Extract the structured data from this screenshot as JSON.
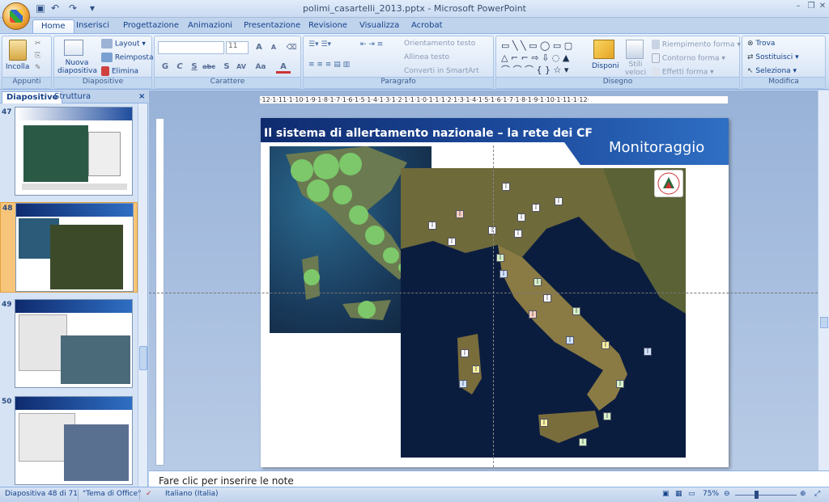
{
  "window": {
    "title": "polimi_casartelli_2013.pptx - Microsoft PowerPoint",
    "controls": {
      "minimize": "–",
      "maximize": "❐",
      "close": "✕"
    }
  },
  "qat": {
    "save_icon": "save-icon",
    "undo_icon": "undo-icon",
    "redo_icon": "redo-icon",
    "customize": "▾"
  },
  "tabs": [
    {
      "label": "Home",
      "active": true
    },
    {
      "label": "Inserisci"
    },
    {
      "label": "Progettazione"
    },
    {
      "label": "Animazioni"
    },
    {
      "label": "Presentazione"
    },
    {
      "label": "Revisione"
    },
    {
      "label": "Visualizza"
    },
    {
      "label": "Acrobat"
    }
  ],
  "ribbon": {
    "appunti": {
      "label": "Appunti",
      "incolla": "Incolla"
    },
    "diapositive": {
      "label": "Diapositive",
      "nuova": "Nuova diapositiva",
      "layout": "Layout",
      "reimposta": "Reimposta",
      "elimina": "Elimina"
    },
    "carattere": {
      "label": "Carattere",
      "font_size": "11",
      "grow": "A",
      "shrink": "A",
      "bold": "G",
      "italic": "C",
      "underline": "S",
      "strike": "abc",
      "shadow": "S",
      "spacing": "AV",
      "case": "Aa",
      "color": "A"
    },
    "paragrafo": {
      "label": "Paragrafo",
      "orientamento": "Orientamento testo",
      "allinea": "Allinea testo",
      "smartart": "Converti in SmartArt"
    },
    "disegno": {
      "label": "Disegno",
      "disponi": "Disponi",
      "stili": "Stili veloci",
      "riempimento": "Riempimento forma",
      "contorno": "Contorno forma",
      "effetti": "Effetti forma"
    },
    "modifica": {
      "label": "Modifica",
      "trova": "Trova",
      "sostituisci": "Sostituisci",
      "seleziona": "Seleziona"
    }
  },
  "pane": {
    "tabs": [
      "Diapositive",
      "Struttura"
    ],
    "close": "×",
    "thumbs": [
      {
        "num": "47"
      },
      {
        "num": "48",
        "selected": true
      },
      {
        "num": "49"
      },
      {
        "num": "50"
      }
    ]
  },
  "ruler": {
    "h_ticks": "·12·1·11·1·10·1·9·1·8·1·7·1·6·1·5·1·4·1·3·1·2·1·1·1·0·1·1·1·2·1·3·1·4·1·5·1·6·1·7·1·8·1·9·1·10·1·11·1·12·"
  },
  "slide": {
    "title": "Il sistema di allertamento nazionale – la rete dei CF",
    "brand": "Monitoraggio"
  },
  "notes": {
    "placeholder": "Fare clic per inserire le note"
  },
  "status": {
    "slide_info": "Diapositiva 48 di 71",
    "theme": "\"Tema di Office\"",
    "language": "Italiano (Italia)",
    "zoom": "75%"
  },
  "colors": {
    "accent": "#15428b",
    "ribbon": "#d3e1f4",
    "slide_header": "#1c4a9c"
  }
}
